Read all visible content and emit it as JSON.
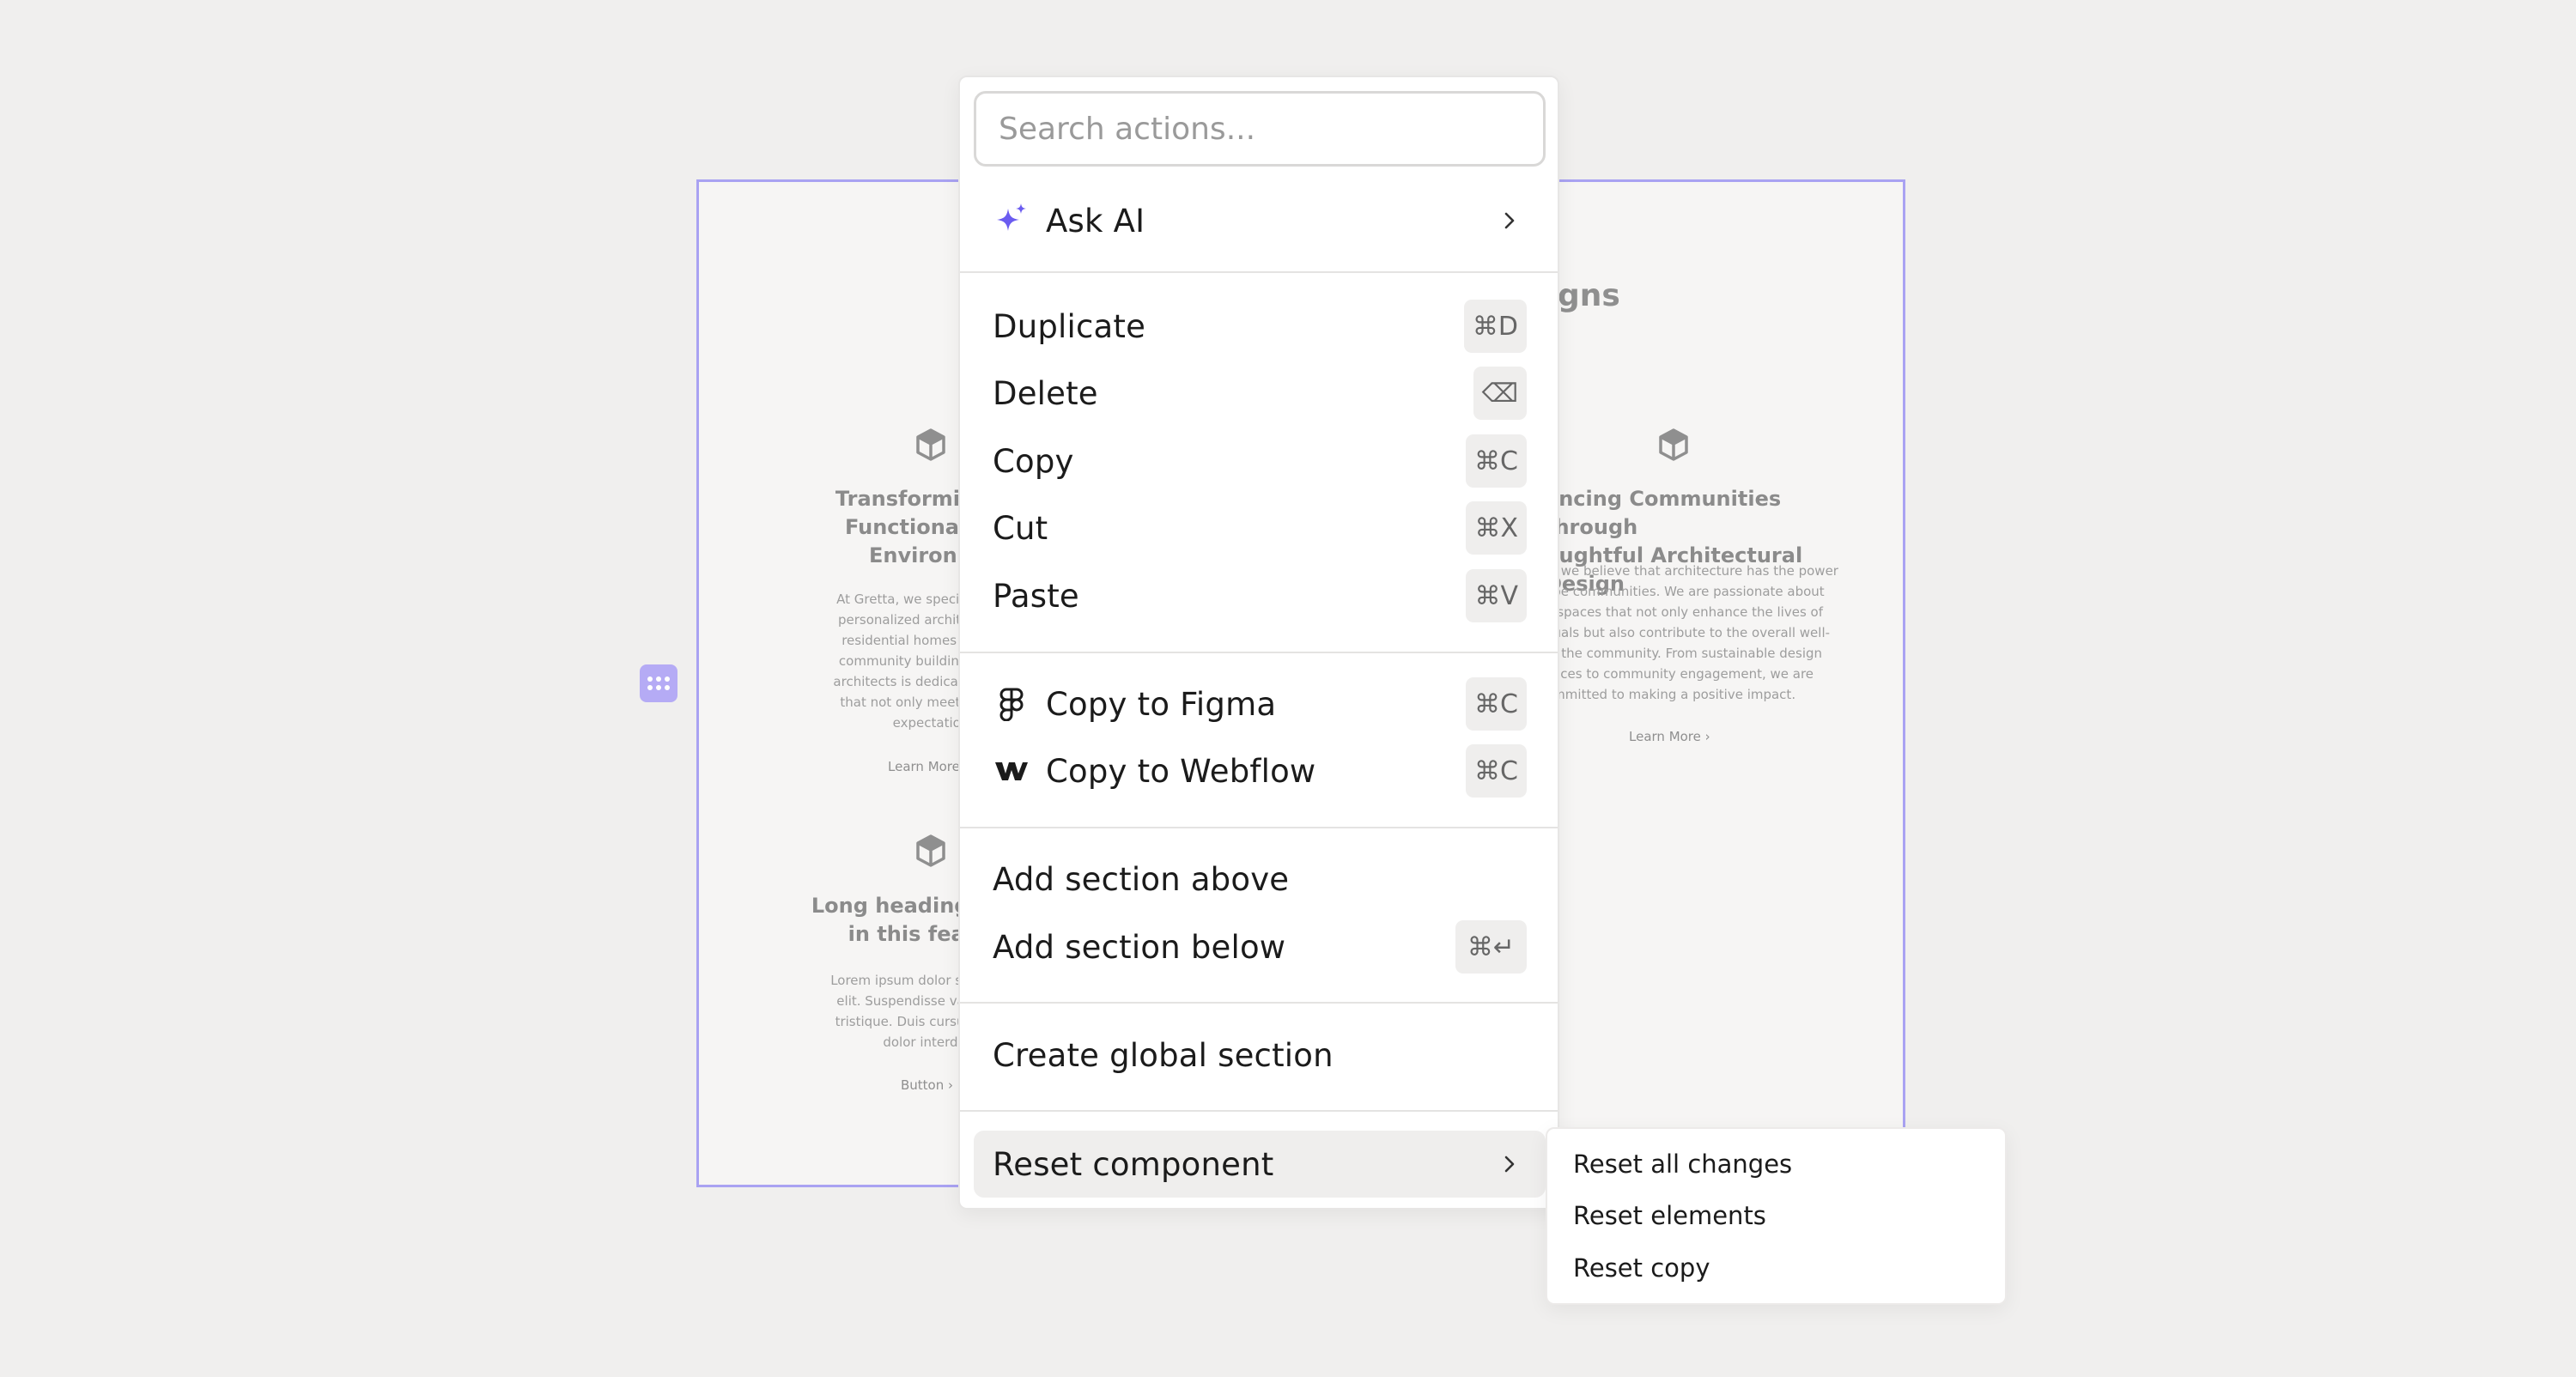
{
  "canvas": {
    "col1": {
      "heading": "Transforming Sp\nFunctional and\nEnvironme",
      "body": "At Gretta, we specialize in de\npersonalized architectural pr\nresidential homes to smalle\ncommunity buildings. Our te\narchitects is dedicated to crea\nthat not only meet your nee\nexpectation",
      "link": "Learn More",
      "heading2": "Long heading is wha\nin this feature",
      "body2": "Lorem ipsum dolor sit amet, co\nelit. Suspendisse varius enim\ntristique. Duis cursus, mi quis\ndolor interdum",
      "link2": "Button"
    },
    "col2": {
      "title": "gns",
      "heading": "ancing Communities through\noughtful Architectural Design",
      "body": "a, we believe that architecture has the power\nape communities. We are passionate about\ng spaces that not only enhance the lives of\nduals but also contribute to the overall well-\nof the community. From sustainable design\nctices to community engagement, we are\nommitted to making a positive impact.",
      "link": "Learn More"
    }
  },
  "menu": {
    "search_placeholder": "Search actions...",
    "ask_ai": "Ask AI",
    "duplicate": {
      "label": "Duplicate",
      "shortcut": "⌘D"
    },
    "delete": {
      "label": "Delete",
      "shortcut": "⌫"
    },
    "copy": {
      "label": "Copy",
      "shortcut": "⌘C"
    },
    "cut": {
      "label": "Cut",
      "shortcut": "⌘X"
    },
    "paste": {
      "label": "Paste",
      "shortcut": "⌘V"
    },
    "copy_figma": {
      "label": "Copy to Figma",
      "shortcut": "⌘C"
    },
    "copy_webflow": {
      "label": "Copy to Webflow",
      "shortcut": "⌘C"
    },
    "add_above": {
      "label": "Add section above"
    },
    "add_below": {
      "label": "Add section below",
      "shortcut": "⌘↵"
    },
    "create_global": {
      "label": "Create global section"
    },
    "reset_component": {
      "label": "Reset component"
    }
  },
  "submenu": {
    "items": [
      "Reset all changes",
      "Reset elements",
      "Reset copy"
    ]
  },
  "colors": {
    "accent": "#6b5cf0",
    "section_border": "#a9a2f2",
    "handle": "#b5abf5"
  },
  "icons": {
    "ai": "sparkle-icon",
    "figma": "figma-icon",
    "webflow": "webflow-icon",
    "feature": "cube-icon",
    "chevron": "chevron-right-icon"
  }
}
